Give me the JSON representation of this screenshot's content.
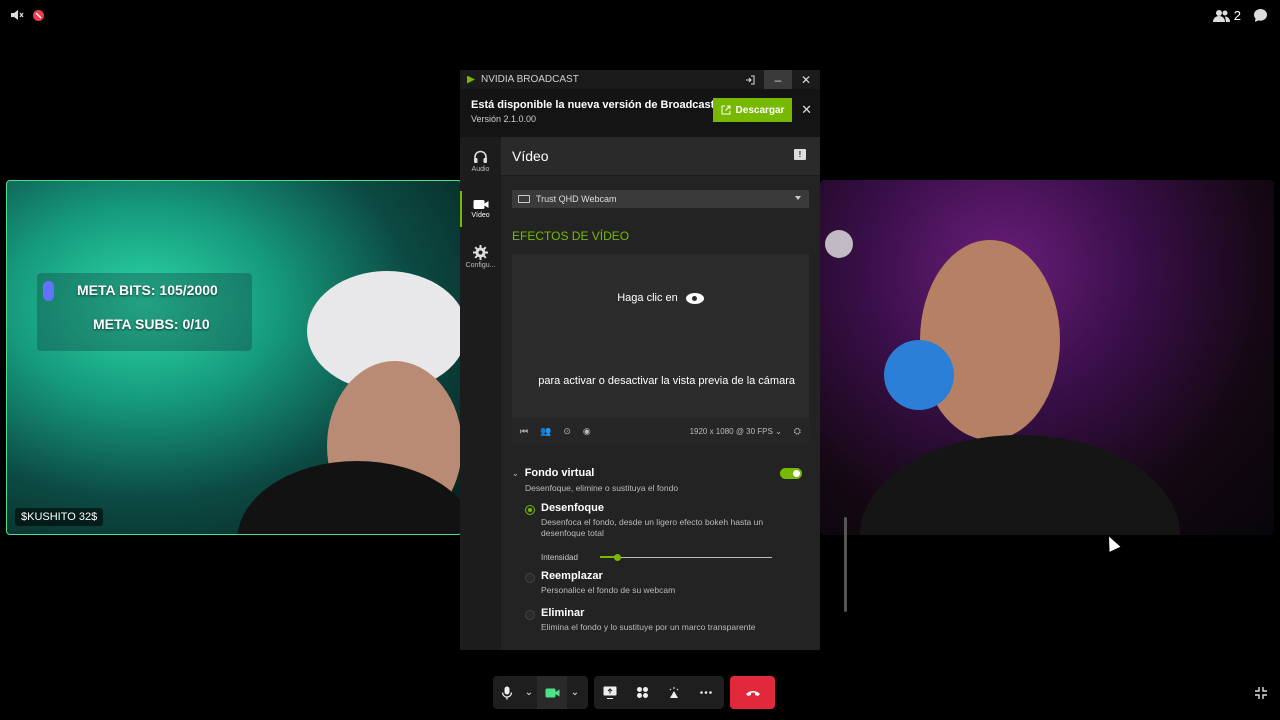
{
  "participants": {
    "count": "2"
  },
  "tiles": {
    "left": {
      "name": "$KUSHITO 32$",
      "meta_bits": "META BITS:  105/2000",
      "meta_subs": "META SUBS:  0/10"
    }
  },
  "broadcast": {
    "title": "NVIDIA BROADCAST",
    "banner": {
      "title": "Está disponible la nueva versión de Broadcast",
      "version": "Versión 2.1.0.00",
      "download": "Descargar"
    },
    "sidebar": [
      {
        "label": "Audio",
        "icon": "headphones-icon"
      },
      {
        "label": "Vídeo",
        "icon": "video-camera-icon"
      },
      {
        "label": "Configu...",
        "icon": "gear-icon"
      }
    ],
    "page_title": "Vídeo",
    "camera": "Trust QHD Webcam",
    "section": "EFECTOS DE VÍDEO",
    "preview": {
      "line1": "Haga clic en",
      "line2": "para activar o desactivar la vista previa de la cámara",
      "resolution": "1920 x 1080 @ 30 FPS"
    },
    "effect": {
      "title": "Fondo virtual",
      "desc": "Desenfoque, elimine o sustituya el fondo",
      "enabled": true,
      "options": [
        {
          "title": "Desenfoque",
          "desc": "Desenfoca el fondo, desde un ligero efecto bokeh hasta un desenfoque total",
          "selected": true
        },
        {
          "title": "Reemplazar",
          "desc": "Personalice el fondo de su webcam",
          "selected": false
        },
        {
          "title": "Eliminar",
          "desc": "Elimina el fondo y lo sustituye por un marco transparente",
          "selected": false
        }
      ],
      "intensity_label": "Intensidad",
      "intensity": 0.1
    }
  },
  "colors": {
    "accent": "#76b900",
    "end_call": "#e2293b"
  }
}
